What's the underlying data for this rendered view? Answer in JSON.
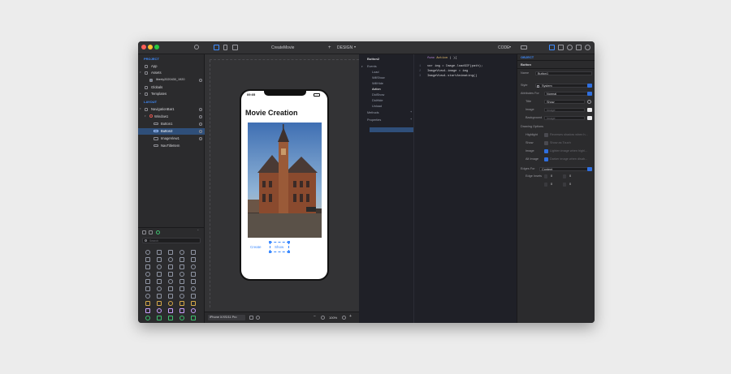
{
  "window": {
    "title": "CreateMovie",
    "design_label": "DESIGN",
    "code_label": "CODE",
    "add_symbol": "+"
  },
  "left": {
    "project_section": "PROJECT",
    "project_items": [
      "App",
      "Assets",
      "Globals",
      "Templates"
    ],
    "asset_file": "liberty2020430_1920",
    "layout_section": "LAYOUT",
    "layout_items": [
      "NavigationBar1",
      "Window1",
      "Button1",
      "Button2",
      "ImageView1",
      "NavTitleItem"
    ],
    "search_placeholder": "Search"
  },
  "canvas": {
    "status_time": "09:05",
    "screen_title": "Movie Creation",
    "create_label": "Create",
    "show_label": "Show",
    "device": "iPhone X/XS/11 Pro",
    "zoom": "100%",
    "minus": "−",
    "plus": "+"
  },
  "code": {
    "object": "Button2",
    "func_keyword": "func",
    "func_name": "Action",
    "func_braces": "( ){",
    "events_label": "Events",
    "events": [
      "Load",
      "WillShow",
      "WillHide",
      "Action",
      "DidShow",
      "DidHide",
      "Unload"
    ],
    "methods_label": "Methods",
    "properties_label": "Properties",
    "lines": [
      "var img = Image.loadGIF(path);",
      "ImageView1.image = img",
      "ImageView1.startAnimating()"
    ]
  },
  "inspector": {
    "object_section": "OBJECT",
    "object_kind": "Button",
    "name_label": "Name",
    "name_value": "Button1",
    "style_label": "Style",
    "style_value": "System",
    "attributes_label": "Attributes For",
    "attributes_value": "Normal",
    "title_label": "Title",
    "title_value": "Show",
    "image_label": "Image",
    "image_value": "Image",
    "background_label": "Background",
    "background_value": "Image",
    "drawing_label": "Drawing Options",
    "highlight_label": "Highlight",
    "highlight_value": "Reverses shadow when h...",
    "show_label": "Show",
    "show_value": "Show as Touch",
    "image2_label": "Image",
    "image2_value": "Lighten image when highl...",
    "alt_label": "Alt Image",
    "alt_value": "Darker image when disab...",
    "edges_label": "Edges For",
    "edges_value": "Content",
    "insets_label": "Edge Insets",
    "inset_values": [
      "0",
      "0",
      "0",
      "0"
    ]
  },
  "colors": {
    "accent": "#3f8cff",
    "window_bg": "#252526",
    "code_bg": "#1f2027"
  }
}
